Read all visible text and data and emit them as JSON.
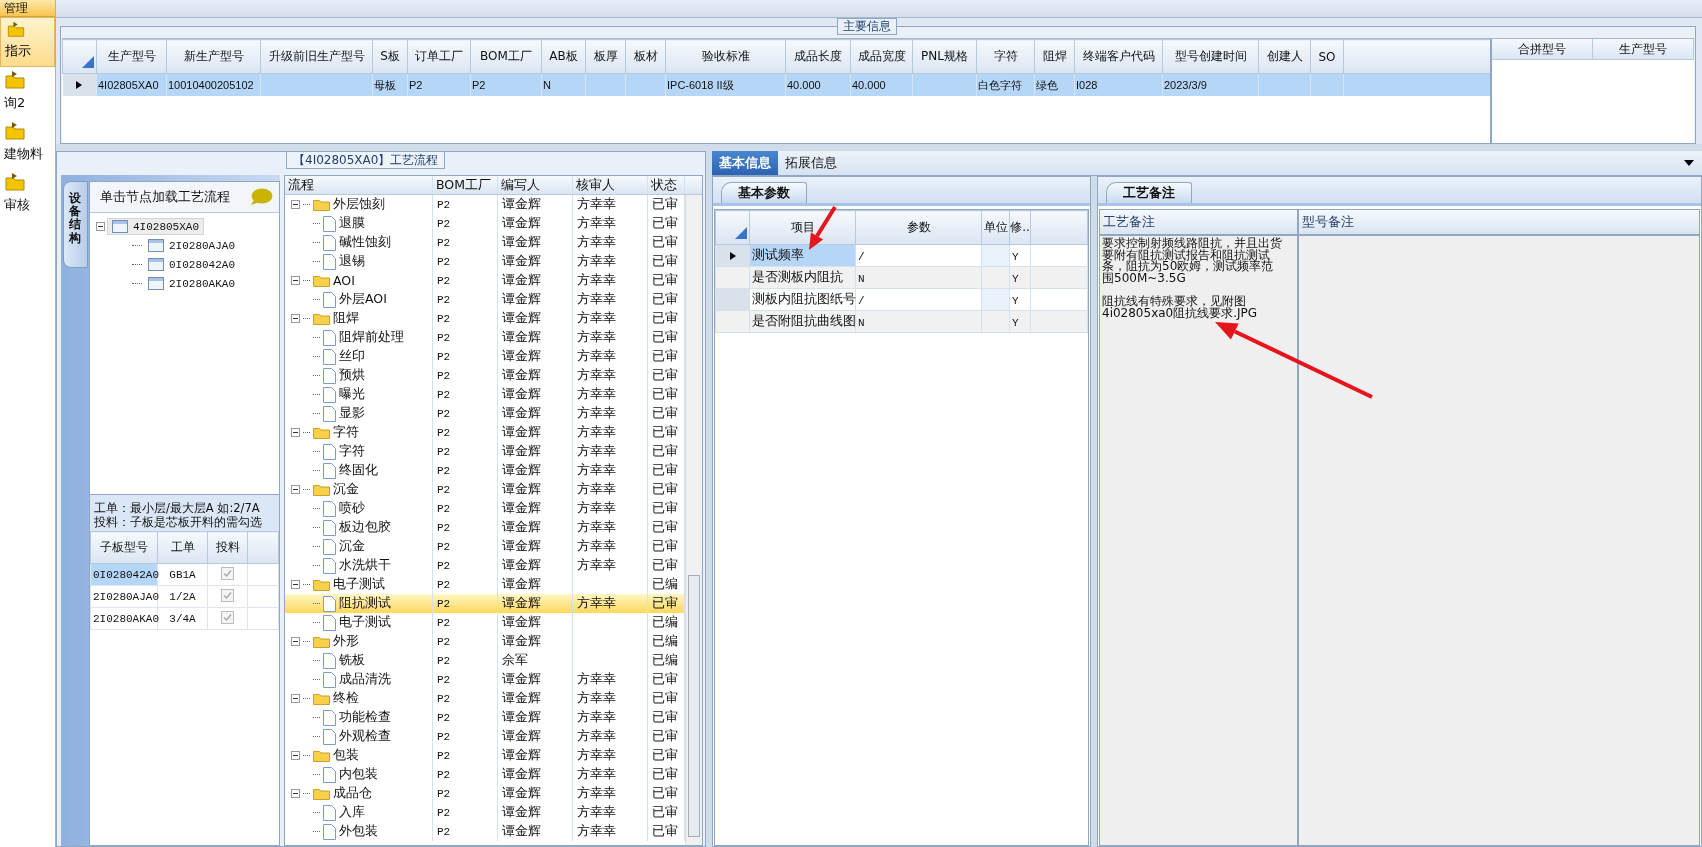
{
  "sidebar": {
    "items": [
      {
        "kind": "group",
        "label": "管理"
      },
      {
        "kind": "item",
        "label": "指示",
        "selected": true
      },
      {
        "kind": "item",
        "label": "询2",
        "selected": false
      },
      {
        "kind": "item",
        "label": "建物料",
        "selected": false
      },
      {
        "kind": "item",
        "label": "审核",
        "selected": false
      }
    ]
  },
  "main_info": {
    "title": "主要信息",
    "columns": [
      "生产型号",
      "新生产型号",
      "升级前旧生产型号",
      "S板",
      "订单工厂",
      "BOM工厂",
      "AB板",
      "板厚",
      "板材",
      "验收标准",
      "成品长度",
      "成品宽度",
      "PNL规格",
      "字符",
      "阻焊",
      "终端客户代码",
      "型号创建时间",
      "创建人",
      "SO"
    ],
    "rows": [
      {
        "selected": true,
        "cells": [
          "4I02805XA0",
          "10010400205102",
          null,
          "母板",
          "P2",
          "P2",
          "N",
          null,
          null,
          "IPC-6018 II级",
          "40.000",
          "40.000",
          null,
          "白色字符",
          "绿色",
          "I028",
          "2023/3/9",
          null,
          null
        ]
      }
    ]
  },
  "merge_table": {
    "columns": [
      "合拼型号",
      "生产型号"
    ]
  },
  "process_flow": {
    "title": "【4I02805XA0】工艺流程",
    "side_tab": "设备结构",
    "hint": "单击节点加载工艺流程",
    "structure_tree": [
      {
        "label": "4I02805XA0",
        "selected": true,
        "expanded": true,
        "children": [
          {
            "label": "2I0280AJA0",
            "selected": false
          },
          {
            "label": "0I028042A0",
            "selected": false
          },
          {
            "label": "2I0280AKA0",
            "selected": false
          }
        ]
      }
    ],
    "notes": [
      "工单：最小层/最大层A 如:2/7A",
      "投料：子板是芯板开料的需勾选"
    ],
    "sub_boards": {
      "columns": [
        "子板型号",
        "工单",
        "投料"
      ],
      "rows": [
        {
          "model": "0I028042A0",
          "work_order": "GB1A",
          "checked": true,
          "selected": true
        },
        {
          "model": "2I0280AJA0",
          "work_order": "1/2A",
          "checked": true,
          "selected": false
        },
        {
          "model": "2I0280AKA0",
          "work_order": "3/4A",
          "checked": true,
          "selected": false
        }
      ]
    },
    "process_grid": {
      "columns": [
        "流程",
        "BOM工厂",
        "编写人",
        "核审人",
        "状态"
      ],
      "rows": [
        {
          "name": "外层蚀刻",
          "bom": "P2",
          "writer": "谭金辉",
          "reviewer": "方幸幸",
          "status": "已审",
          "expanded": true,
          "selected": false,
          "children": [
            {
              "name": "退膜",
              "bom": "P2",
              "writer": "谭金辉",
              "reviewer": "方幸幸",
              "status": "已审",
              "selected": false
            },
            {
              "name": "碱性蚀刻",
              "bom": "P2",
              "writer": "谭金辉",
              "reviewer": "方幸幸",
              "status": "已审",
              "selected": false
            },
            {
              "name": "退锡",
              "bom": "P2",
              "writer": "谭金辉",
              "reviewer": "方幸幸",
              "status": "已审",
              "selected": false
            }
          ]
        },
        {
          "name": "AOI",
          "bom": "P2",
          "writer": "谭金辉",
          "reviewer": "方幸幸",
          "status": "已审",
          "expanded": true,
          "selected": false,
          "children": [
            {
              "name": "外层AOI",
              "bom": "P2",
              "writer": "谭金辉",
              "reviewer": "方幸幸",
              "status": "已审",
              "selected": false
            }
          ]
        },
        {
          "name": "阻焊",
          "bom": "P2",
          "writer": "谭金辉",
          "reviewer": "方幸幸",
          "status": "已审",
          "expanded": true,
          "selected": false,
          "children": [
            {
              "name": "阻焊前处理",
              "bom": "P2",
              "writer": "谭金辉",
              "reviewer": "方幸幸",
              "status": "已审",
              "selected": false
            },
            {
              "name": "丝印",
              "bom": "P2",
              "writer": "谭金辉",
              "reviewer": "方幸幸",
              "status": "已审",
              "selected": false
            },
            {
              "name": "预烘",
              "bom": "P2",
              "writer": "谭金辉",
              "reviewer": "方幸幸",
              "status": "已审",
              "selected": false
            },
            {
              "name": "曝光",
              "bom": "P2",
              "writer": "谭金辉",
              "reviewer": "方幸幸",
              "status": "已审",
              "selected": false
            },
            {
              "name": "显影",
              "bom": "P2",
              "writer": "谭金辉",
              "reviewer": "方幸幸",
              "status": "已审",
              "selected": false
            }
          ]
        },
        {
          "name": "字符",
          "bom": "P2",
          "writer": "谭金辉",
          "reviewer": "方幸幸",
          "status": "已审",
          "expanded": true,
          "selected": false,
          "children": [
            {
              "name": "字符",
              "bom": "P2",
              "writer": "谭金辉",
              "reviewer": "方幸幸",
              "status": "已审",
              "selected": false
            },
            {
              "name": "终固化",
              "bom": "P2",
              "writer": "谭金辉",
              "reviewer": "方幸幸",
              "status": "已审",
              "selected": false
            }
          ]
        },
        {
          "name": "沉金",
          "bom": "P2",
          "writer": "谭金辉",
          "reviewer": "方幸幸",
          "status": "已审",
          "expanded": true,
          "selected": false,
          "children": [
            {
              "name": "喷砂",
              "bom": "P2",
              "writer": "谭金辉",
              "reviewer": "方幸幸",
              "status": "已审",
              "selected": false
            },
            {
              "name": "板边包胶",
              "bom": "P2",
              "writer": "谭金辉",
              "reviewer": "方幸幸",
              "status": "已审",
              "selected": false
            },
            {
              "name": "沉金",
              "bom": "P2",
              "writer": "谭金辉",
              "reviewer": "方幸幸",
              "status": "已审",
              "selected": false
            },
            {
              "name": "水洗烘干",
              "bom": "P2",
              "writer": "谭金辉",
              "reviewer": "方幸幸",
              "status": "已审",
              "selected": false
            }
          ]
        },
        {
          "name": "电子测试",
          "bom": "P2",
          "writer": "谭金辉",
          "status": "已编",
          "expanded": true,
          "selected": false,
          "children": [
            {
              "name": "阻抗测试",
              "bom": "P2",
              "writer": "谭金辉",
              "reviewer": "方幸幸",
              "status": "已审",
              "selected": true
            },
            {
              "name": "电子测试",
              "bom": "P2",
              "writer": "谭金辉",
              "status": "已编",
              "selected": false
            }
          ]
        },
        {
          "name": "外形",
          "bom": "P2",
          "writer": "谭金辉",
          "status": "已编",
          "expanded": true,
          "selected": false,
          "children": [
            {
              "name": "铣板",
              "bom": "P2",
              "writer": "佘军",
              "status": "已编",
              "selected": false
            },
            {
              "name": "成品清洗",
              "bom": "P2",
              "writer": "谭金辉",
              "reviewer": "方幸幸",
              "status": "已审",
              "selected": false
            }
          ]
        },
        {
          "name": "终检",
          "bom": "P2",
          "writer": "谭金辉",
          "reviewer": "方幸幸",
          "status": "已审",
          "expanded": true,
          "selected": false,
          "children": [
            {
              "name": "功能检查",
              "bom": "P2",
              "writer": "谭金辉",
              "reviewer": "方幸幸",
              "status": "已审",
              "selected": false
            },
            {
              "name": "外观检查",
              "bom": "P2",
              "writer": "谭金辉",
              "reviewer": "方幸幸",
              "status": "已审",
              "selected": false
            }
          ]
        },
        {
          "name": "包装",
          "bom": "P2",
          "writer": "谭金辉",
          "reviewer": "方幸幸",
          "status": "已审",
          "expanded": true,
          "selected": false,
          "children": [
            {
              "name": "内包装",
              "bom": "P2",
              "writer": "谭金辉",
              "reviewer": "方幸幸",
              "status": "已审",
              "selected": false
            }
          ]
        },
        {
          "name": "成品仓",
          "bom": "P2",
          "writer": "谭金辉",
          "reviewer": "方幸幸",
          "status": "已审",
          "expanded": true,
          "selected": false,
          "children": [
            {
              "name": "入库",
              "bom": "P2",
              "writer": "谭金辉",
              "reviewer": "方幸幸",
              "status": "已审",
              "selected": false
            },
            {
              "name": "外包装",
              "bom": "P2",
              "writer": "谭金辉",
              "reviewer": "方幸幸",
              "status": "已审",
              "selected": false
            }
          ]
        }
      ]
    }
  },
  "details": {
    "tabs": [
      {
        "label": "基本信息",
        "selected": true
      },
      {
        "label": "拓展信息",
        "selected": false
      }
    ],
    "params": {
      "tab": "基本参数",
      "columns": [
        "项目",
        "参数",
        "单位",
        "修.."
      ],
      "rows": [
        {
          "item": "测试频率",
          "value": "/",
          "flag": "Y",
          "selected": true
        },
        {
          "item": "是否测板内阻抗",
          "value": "N",
          "flag": "Y",
          "selected": false
        },
        {
          "item": "测板内阻抗图纸号",
          "value": "/",
          "flag": "Y",
          "selected": false
        },
        {
          "item": "是否附阻抗曲线图",
          "value": "N",
          "flag": "Y",
          "selected": false
        }
      ]
    },
    "remarks": {
      "tab": "工艺备注",
      "columns": [
        "工艺备注",
        "型号备注"
      ],
      "text": [
        "要求控制射频线路阻抗，并且出货要附有阻抗测试报告和阻抗测试条，阻抗为50欧姆，测试频率范围500M~3.5G",
        "阻抗线有特殊要求，见附图",
        "4i02805xa0阻抗线要求.JPG"
      ]
    }
  }
}
